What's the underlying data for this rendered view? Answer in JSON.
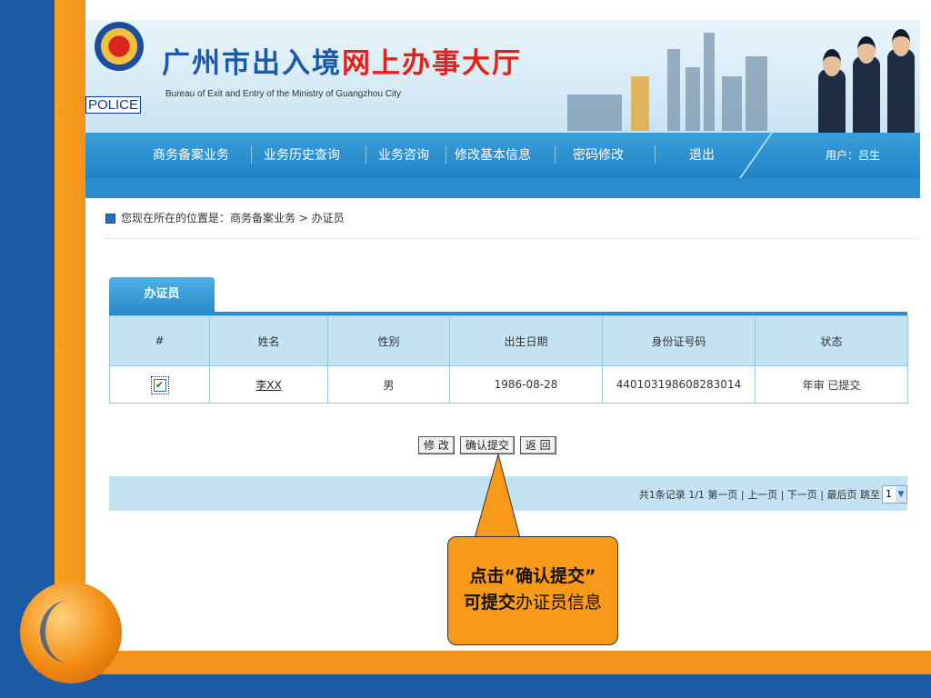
{
  "banner": {
    "police_tag": "POLICE",
    "title_part1": "广州市出入境",
    "title_part2": "网上办事大厅",
    "subtitle": "Bureau of Exit and Entry of the Ministry of  Guangzhou City"
  },
  "nav": {
    "items": [
      "商务备案业务",
      "业务历史查询",
      "业务咨询",
      "修改基本信息",
      "密码修改",
      "退出"
    ],
    "user": "用户：吕生"
  },
  "breadcrumb": "您现在所在的位置是：商务备案业务 > 办证员",
  "tab": "办证员",
  "table": {
    "headers": [
      "#",
      "姓名",
      "性别",
      "出生日期",
      "身份证号码",
      "状态"
    ],
    "rows": [
      {
        "checked": true,
        "name": "李XX",
        "gender": "男",
        "birth": "1986-08-28",
        "id": "440103198608283014",
        "status": "年审 已提交"
      }
    ]
  },
  "buttons": {
    "edit": "修 改",
    "confirm": "确认提交",
    "back": "返 回"
  },
  "pager": {
    "text": "共1条记录  1/1  第一页 | 上一页 | 下一页 | 最后页  跳至",
    "page": "1"
  },
  "callout": {
    "l1_bold": "点击“确认提交”",
    "l2_bold": "可提交",
    "l2_rest": "办证员信息"
  },
  "colors": {
    "brand_blue": "#1f84c7",
    "orange": "#f4931e",
    "title_red": "#e0231b"
  }
}
